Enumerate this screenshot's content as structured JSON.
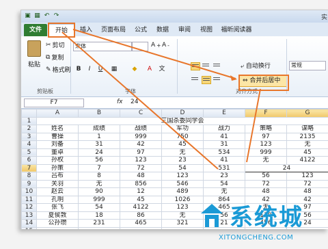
{
  "title_right": "实",
  "tabs": [
    "文件",
    "开始",
    "插入",
    "页面布局",
    "公式",
    "数据",
    "审阅",
    "视图",
    "福昕阅读器"
  ],
  "clipboard": {
    "cut": "剪切",
    "copy": "复制",
    "format_painter": "格式刷",
    "paste": "粘贴",
    "group": "剪贴板"
  },
  "font": {
    "name": "宋体",
    "bold": "B",
    "italic": "I",
    "underline": "U",
    "group": "字体"
  },
  "alignment": {
    "wrap": "自动换行",
    "merge": "合并后居中",
    "group": "对齐方式"
  },
  "number": {
    "format": "常规"
  },
  "formula_bar": {
    "name_box": "F7",
    "fx": "fx",
    "value": "24"
  },
  "columns": [
    "A",
    "B",
    "C",
    "D",
    "E",
    "F",
    "G"
  ],
  "rows": [
    {
      "n": "1",
      "cells": [
        "三国杀委同学会"
      ]
    },
    {
      "n": "2",
      "cells": [
        "姓名",
        "成绩",
        "战绩",
        "军功",
        "战力",
        "策略",
        "谋略"
      ]
    },
    {
      "n": "3",
      "cells": [
        "曹操",
        "1",
        "999",
        "750",
        "41",
        "97",
        "2135"
      ]
    },
    {
      "n": "4",
      "cells": [
        "刘备",
        "31",
        "42",
        "45",
        "31",
        "123",
        "无"
      ]
    },
    {
      "n": "5",
      "cells": [
        "董卓",
        "24",
        "97",
        "无",
        "534",
        "999",
        "45"
      ]
    },
    {
      "n": "6",
      "cells": [
        "孙权",
        "56",
        "123",
        "23",
        "41",
        "无",
        "4122"
      ]
    },
    {
      "n": "7",
      "cells": [
        "孙策",
        "7",
        "72",
        "54",
        "531",
        "24"
      ]
    },
    {
      "n": "8",
      "cells": [
        "吕布",
        "8",
        "48",
        "123",
        "23",
        "56",
        "123"
      ]
    },
    {
      "n": "9",
      "cells": [
        "关羽",
        "无",
        "856",
        "546",
        "54",
        "72",
        "72"
      ]
    },
    {
      "n": "10",
      "cells": [
        "赵云",
        "90",
        "12",
        "489",
        "无",
        "48",
        "48"
      ]
    },
    {
      "n": "11",
      "cells": [
        "孔明",
        "999",
        "45",
        "1026",
        "864",
        "42",
        "42"
      ]
    },
    {
      "n": "12",
      "cells": [
        "张飞",
        "54",
        "4122",
        "123",
        "465",
        "无",
        "97"
      ]
    },
    {
      "n": "13",
      "cells": [
        "夏侯敦",
        "18",
        "86",
        "无",
        "56",
        "120",
        "56"
      ]
    },
    {
      "n": "14",
      "cells": [
        "公孙瓒",
        "231",
        "465",
        "321",
        "21",
        "456",
        "24"
      ]
    },
    {
      "n": "15",
      "cells": [
        "......",
        "......",
        "......",
        "......",
        "......",
        "......",
        "......"
      ]
    }
  ],
  "watermark": {
    "brand": "系统城",
    "url": "XITONGCHENG.COM"
  },
  "colors": {
    "file_tab": "#2f7d32",
    "annotation": "#e8762b",
    "merge_highlight": "#fce6a6",
    "watermark": "#1a9ad6"
  }
}
